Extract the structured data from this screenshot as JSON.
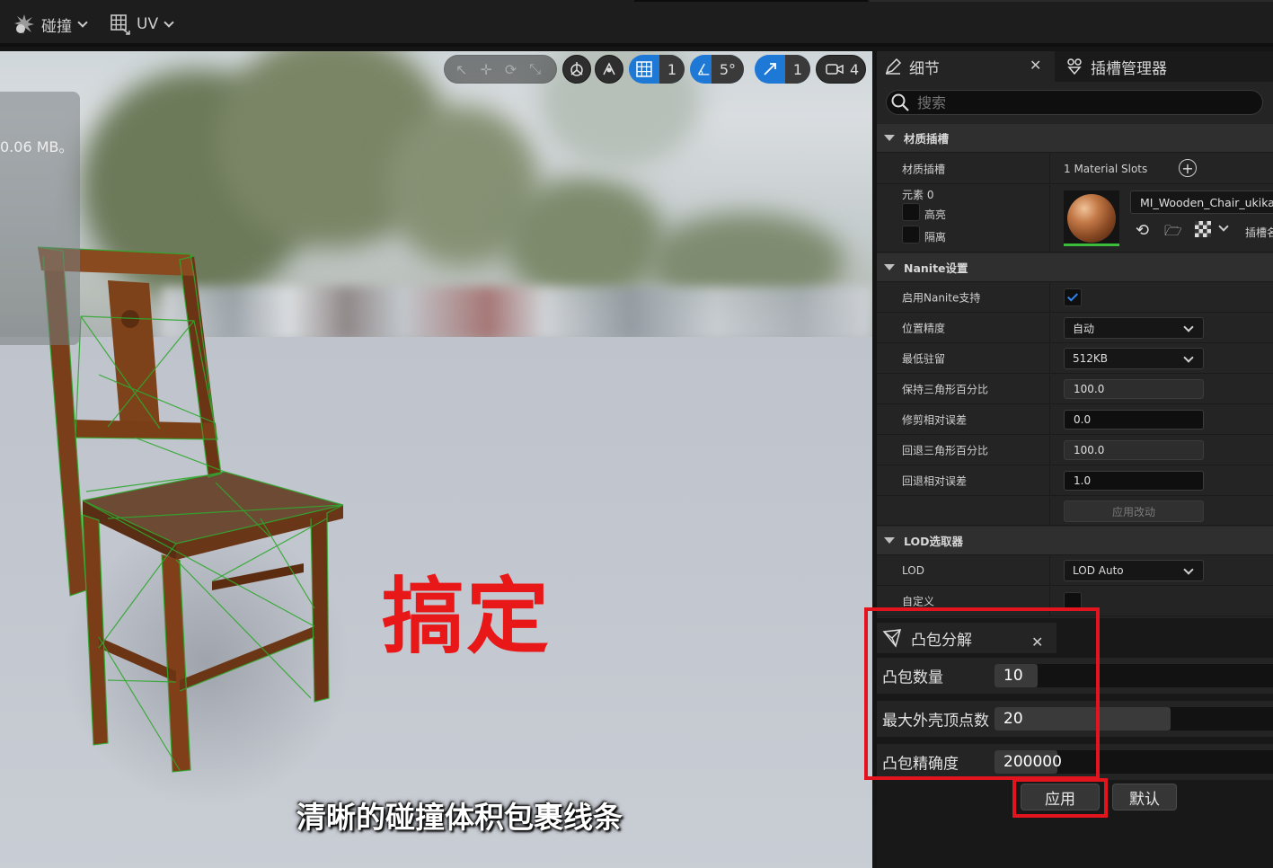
{
  "toolbar": {
    "collision_label": "碰撞",
    "uv_label": "UV"
  },
  "viewport": {
    "memory_text": "0.06 MB。",
    "grid_snap_value": "1",
    "angle_snap_value": "5°",
    "scale_snap_value": "1",
    "camera_speed_value": "4",
    "overlay_text": "搞定",
    "subtitle": "清晰的碰撞体积包裹线条"
  },
  "details": {
    "tab_details": "细节",
    "tab_socket_manager": "插槽管理器",
    "search_placeholder": "搜索",
    "material_section": {
      "title": "材质插槽",
      "slots_label": "材质插槽",
      "slots_value": "1 Material Slots",
      "element_label": "元素 0",
      "highlight_label": "高亮",
      "isolate_label": "隔离",
      "material_name": "MI_Wooden_Chair_ukikajn",
      "slot_label": "插槽名"
    },
    "nanite_section": {
      "title": "Nanite设置",
      "enable_label": "启用Nanite支持",
      "enable_value": true,
      "position_precision_label": "位置精度",
      "position_precision_value": "自动",
      "min_residency_label": "最低驻留",
      "min_residency_value": "512KB",
      "keep_triangle_percent_label": "保持三角形百分比",
      "keep_triangle_percent_value": "100.0",
      "trim_relative_error_label": "修剪相对误差",
      "trim_relative_error_value": "0.0",
      "fallback_triangle_percent_label": "回退三角形百分比",
      "fallback_triangle_percent_value": "100.0",
      "fallback_relative_error_label": "回退相对误差",
      "fallback_relative_error_value": "1.0",
      "apply_changes_label": "应用改动"
    },
    "lod_section": {
      "title": "LOD选取器",
      "lod_label": "LOD",
      "lod_value": "LOD Auto",
      "custom_label": "自定义"
    }
  },
  "convex_decomposition": {
    "tab_title": "凸包分解",
    "hull_count_label": "凸包数量",
    "hull_count_value": "10",
    "max_hull_verts_label": "最大外壳顶点数",
    "max_hull_verts_value": "20",
    "hull_precision_label": "凸包精确度",
    "hull_precision_value": "200000",
    "apply_label": "应用",
    "default_label": "默认"
  },
  "colors": {
    "accent_blue": "#1e79d6",
    "highlight_red": "#e2141e",
    "overlay_red": "#e81818"
  }
}
